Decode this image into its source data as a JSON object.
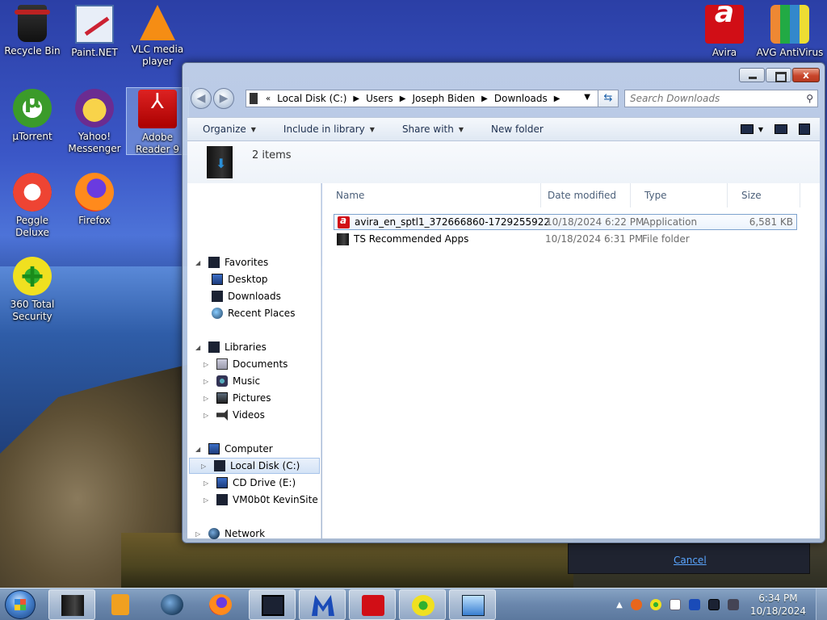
{
  "desktop": {
    "icons": [
      {
        "label": "Recycle Bin"
      },
      {
        "label": "Paint.NET"
      },
      {
        "label": "VLC media player"
      },
      {
        "label": "µTorrent"
      },
      {
        "label": "Yahoo! Messenger"
      },
      {
        "label": "Adobe Reader 9"
      },
      {
        "label": "Peggle Deluxe"
      },
      {
        "label": "Firefox"
      },
      {
        "label": "360 Total Security"
      },
      {
        "label": "Avira"
      },
      {
        "label": "AVG AntiVirus"
      }
    ]
  },
  "explorer": {
    "close_glyph": "x",
    "address": {
      "overflow": "«",
      "crumbs": [
        "Local Disk (C:)",
        "Users",
        "Joseph Biden",
        "Downloads"
      ]
    },
    "search": {
      "placeholder": "Search Downloads"
    },
    "toolbar": {
      "organize": "Organize",
      "include_in_library": "Include in library",
      "share_with": "Share with",
      "new_folder": "New folder"
    },
    "item_count": "2 items",
    "nav": {
      "favorites": "Favorites",
      "desktop": "Desktop",
      "downloads": "Downloads",
      "recent_places": "Recent Places",
      "libraries": "Libraries",
      "documents": "Documents",
      "music": "Music",
      "pictures": "Pictures",
      "videos": "Videos",
      "computer": "Computer",
      "local_disk": "Local Disk (C:)",
      "cd_drive": "CD Drive (E:)",
      "vm_site": "VM0b0t KevinSite",
      "network": "Network"
    },
    "columns": {
      "name": "Name",
      "date": "Date modified",
      "type": "Type",
      "size": "Size"
    },
    "files": [
      {
        "name": "avira_en_sptl1_372666860-1729255922-17...",
        "date": "10/18/2024 6:22 PM",
        "type": "Application",
        "size": "6,581 KB",
        "icon": "avira-icon"
      },
      {
        "name": "TS Recommended Apps",
        "date": "10/18/2024 6:31 PM",
        "type": "File folder",
        "size": "",
        "icon": "folder-icon"
      }
    ]
  },
  "background_dialog": {
    "cancel": "Cancel"
  },
  "taskbar": {
    "clock_time": "6:34 PM",
    "clock_date": "10/18/2024"
  },
  "colors": {
    "accent": "#3b6ec7",
    "avira_red": "#d10e16",
    "close_red": "#c8452b"
  }
}
